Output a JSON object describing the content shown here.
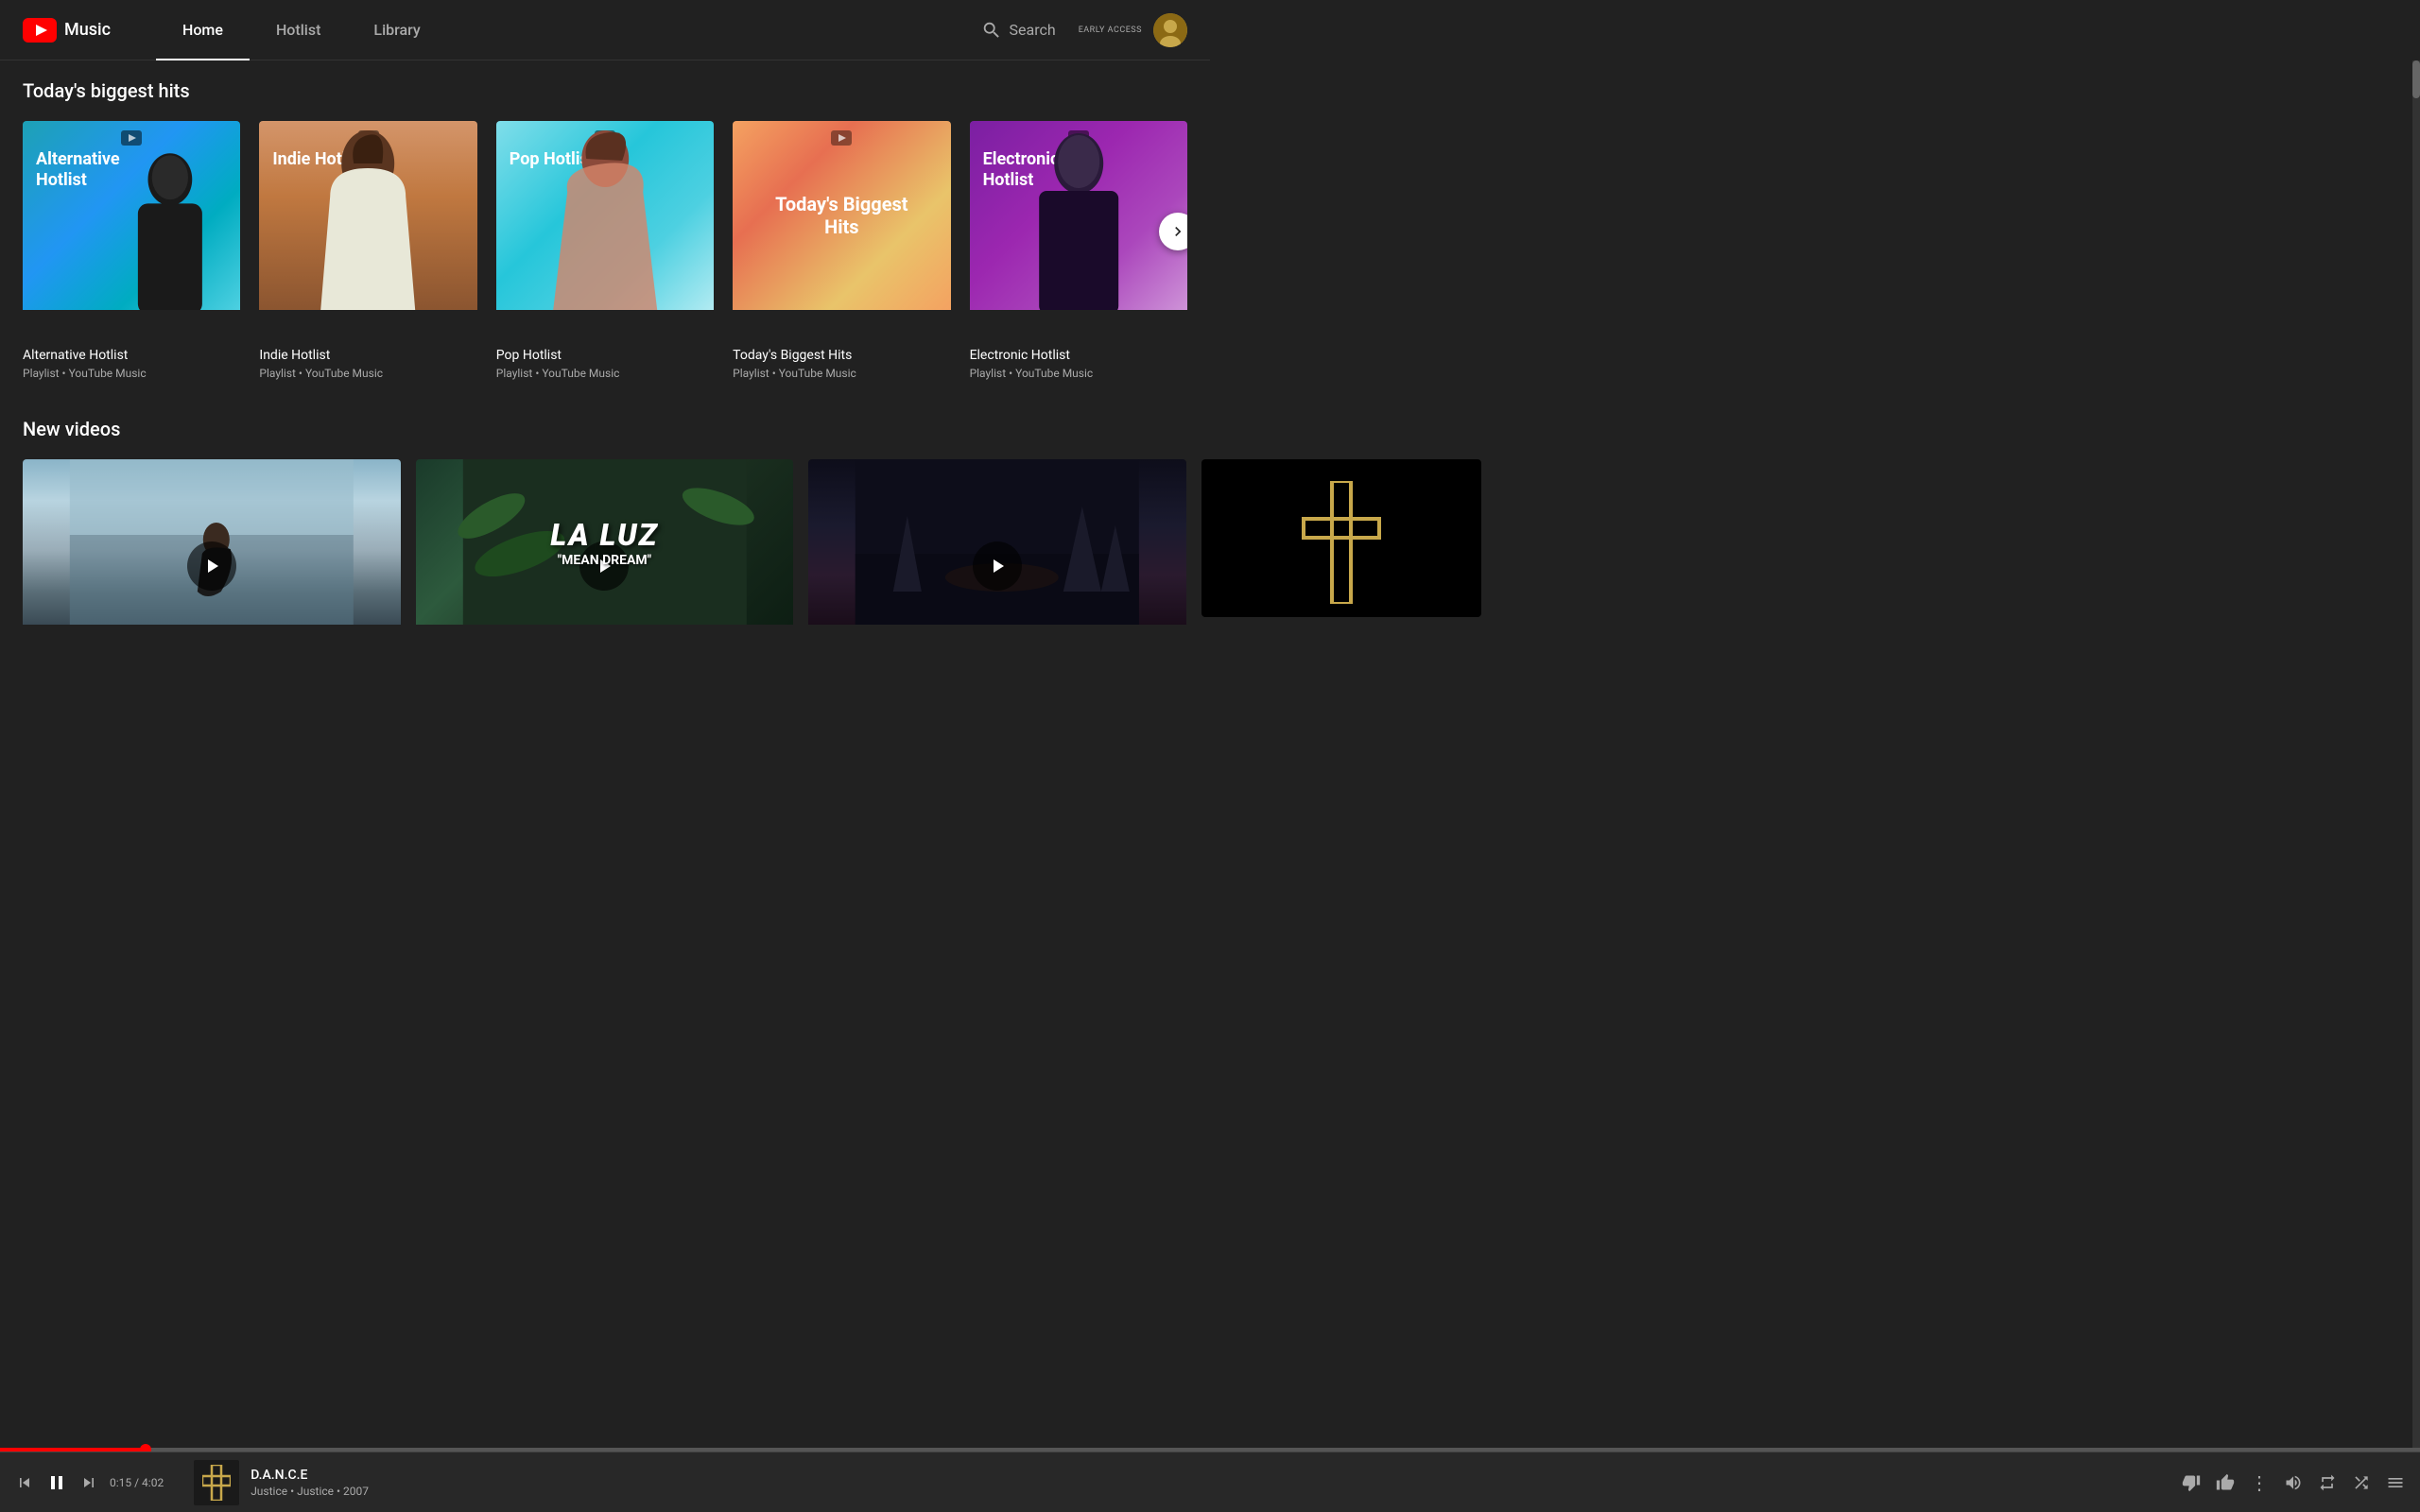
{
  "header": {
    "logo_text": "Music",
    "nav": [
      {
        "label": "Home",
        "active": true
      },
      {
        "label": "Hotlist",
        "active": false
      },
      {
        "label": "Library",
        "active": false
      }
    ],
    "search_label": "Search",
    "early_access": "EARLY ACCESS"
  },
  "sections": {
    "biggest_hits": {
      "title": "Today's biggest hits",
      "cards": [
        {
          "id": "alt-hotlist",
          "title": "Alternative Hotlist",
          "subtitle": "Playlist • YouTube Music",
          "card_label": "Alternative\nHotlist",
          "bg_type": "alt"
        },
        {
          "id": "indie-hotlist",
          "title": "Indie Hotlist",
          "subtitle": "Playlist • YouTube Music",
          "card_label": "Indie Hotlist",
          "bg_type": "indie"
        },
        {
          "id": "pop-hotlist",
          "title": "Pop Hotlist",
          "subtitle": "Playlist • YouTube Music",
          "card_label": "Pop Hotlist",
          "bg_type": "pop"
        },
        {
          "id": "biggest-hits",
          "title": "Today's Biggest Hits",
          "subtitle": "Playlist • YouTube Music",
          "card_label": "Today's Biggest\nHits",
          "bg_type": "biggest"
        },
        {
          "id": "electronic-hotlist",
          "title": "Electronic Hotlist",
          "subtitle": "Playlist • YouTube Music",
          "card_label": "Electronic\nHotlist",
          "bg_type": "electronic"
        }
      ]
    },
    "new_videos": {
      "title": "New videos",
      "videos": [
        {
          "id": "video1",
          "bg_type": "ocean"
        },
        {
          "id": "video2",
          "title": "LA LUZ",
          "subtitle": "\"MEAN DREAM\"",
          "bg_type": "laluz"
        },
        {
          "id": "video3",
          "bg_type": "dark"
        },
        {
          "id": "video4",
          "bg_type": "cross",
          "partial": true
        }
      ]
    }
  },
  "player": {
    "track_title": "D.A.N.C.E",
    "track_artist": "Justice • Justice • 2007",
    "time_current": "0:15",
    "time_total": "4:02",
    "time_display": "0:15 / 4:02",
    "progress_pct": 6
  }
}
